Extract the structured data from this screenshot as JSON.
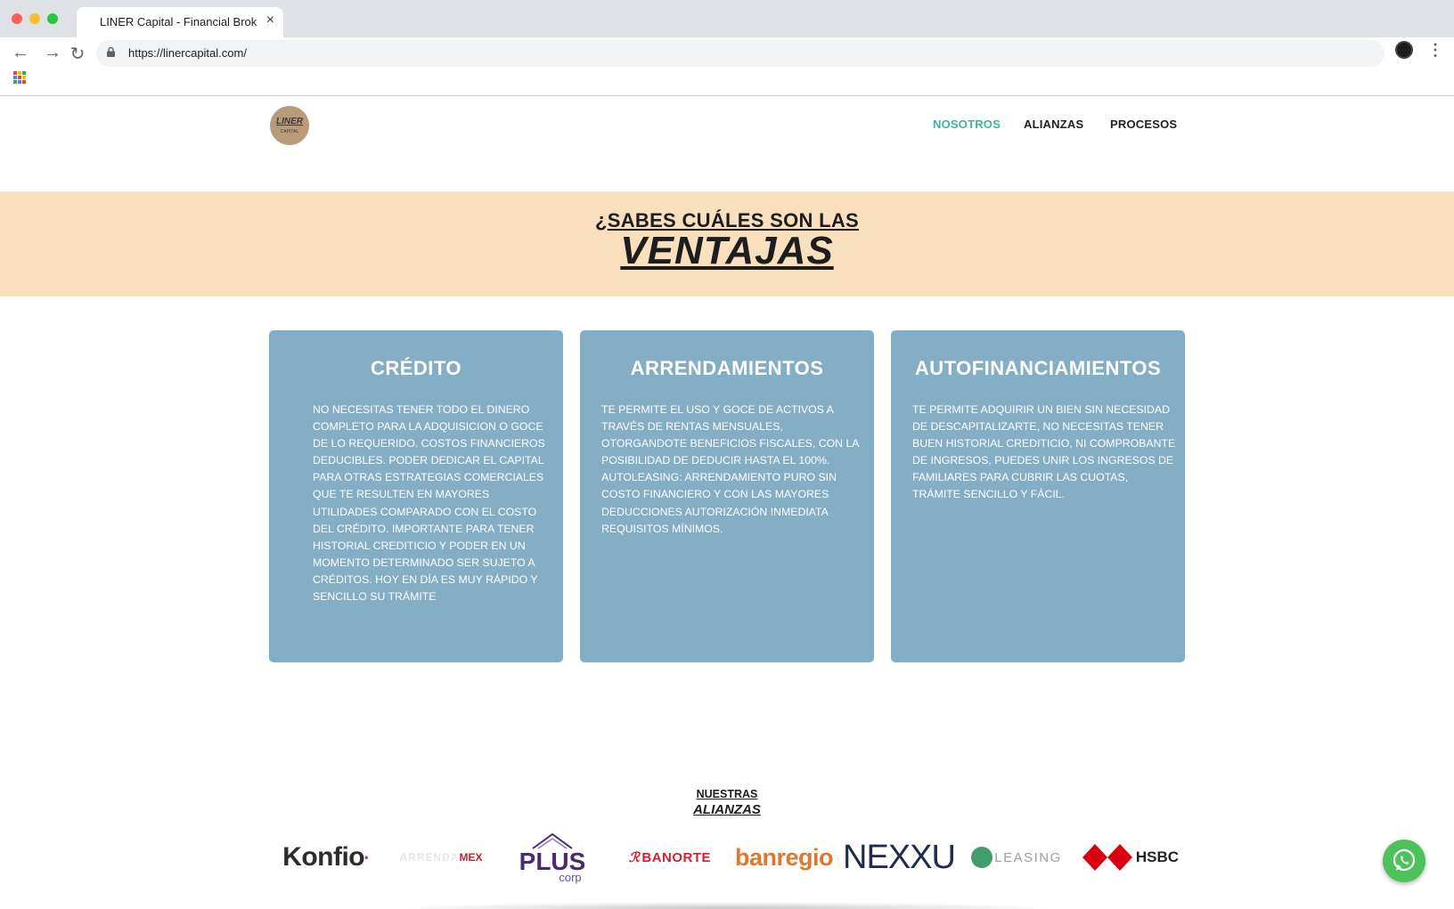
{
  "browser": {
    "tab_title": "LINER Capital - Financial Brok",
    "tab_close": "×",
    "url": "https://linercapital.com/",
    "back": "←",
    "forward": "→",
    "reload": "↻",
    "menu": "⋮"
  },
  "site": {
    "logo_text": "LINER",
    "logo_subtext": "CAPITAL",
    "nav": [
      {
        "label": "NOSOTROS",
        "active": true
      },
      {
        "label": "ALIANZAS",
        "active": false
      },
      {
        "label": "PROCESOS",
        "active": false
      }
    ],
    "accent_color": "#3bb59a"
  },
  "hero": {
    "line1_prefix": "¿",
    "line1_underlined": "SABES CUÁLES SON LAS",
    "line2": "VENTAJAS",
    "background_color": "#f8dfbd"
  },
  "cards": [
    {
      "title": "CRÉDITO",
      "body": "No necesitas tener todo el dinero completo para la adquisicion o goce de lo requerido. Costos financieros deducibles. Poder dedicar el capital para otras estrategias comerciales que te resulten en mayores utilidades comparado con el costo del crédito. Importante para tener historial crediticio y poder en un momento determinado ser sujeto a créditos. Hoy en día es muy rápido y sencillo su trámite"
    },
    {
      "title": "ARRENDAMIENTOS",
      "body": "Te permite el uso y goce de activos a través de rentas mensuales, otorgandote beneficios fiscales, con la posibilidad de deducir hasta el 100%. Autoleasing: arrendamiento puro sin costo financiero y con las mayores deducciones autorización inmediata requisitos mínimos."
    },
    {
      "title": "AUTOFINANCIAMIENTOS",
      "body": "Te permite adquirir un bien sin necesidad de descapitalizarte, no necesitas tener buen historial crediticio, ni comprobante de ingresos, puedes unir los ingresos de familiares para cubrir las cuotas, trámite sencillo y fácil."
    }
  ],
  "card_color": "#84aec5",
  "alliances": {
    "line1": "NUESTRAS",
    "line2": "ALIANZAS",
    "partners": {
      "konfio": "Konfio",
      "arrenda": "MEX",
      "plus": "PLUS",
      "plus_sub": "corp",
      "banorte": "BANORTE",
      "banregio": "banregio",
      "nexxu": "NEXXU",
      "cs_leasing": "LEASING",
      "hsbc": "HSBC"
    }
  },
  "whatsapp_icon": "whatsapp-icon"
}
